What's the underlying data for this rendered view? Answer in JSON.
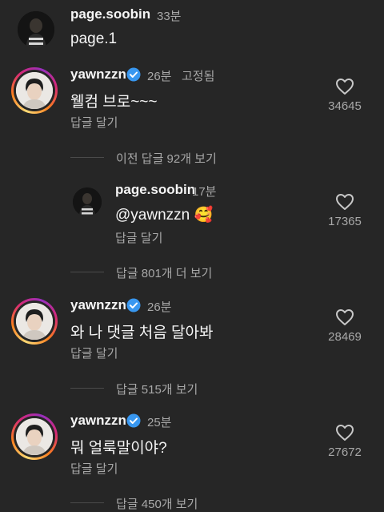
{
  "top_comment": {
    "username": "page.soobin",
    "time": "33분",
    "text": "page.1"
  },
  "comments": [
    {
      "username": "yawnzzn",
      "time": "26분",
      "pinned": "고정됨",
      "text": "웰컴 브로~~~",
      "reply": "답글 달기",
      "likes": "34645",
      "verified": true
    },
    {
      "username": "yawnzzn",
      "time": "26분",
      "text": "와 나 댓글 처음 달아봐",
      "reply": "답글 달기",
      "likes": "28469",
      "verified": true
    },
    {
      "username": "yawnzzn",
      "time": "25분",
      "text": "뭐 얼룩말이야?",
      "reply": "답글 달기",
      "likes": "27672",
      "verified": true
    }
  ],
  "prev_replies": "이전 답글 92개 보기",
  "reply": {
    "username": "page.soobin",
    "time": "17분",
    "text": "@yawnzzn 🥰",
    "reply_label": "답글 달기",
    "likes": "17365"
  },
  "more_replies": [
    "답글 801개 더 보기",
    "답글 515개 보기",
    "답글 450개 보기"
  ],
  "colors": {
    "background": "#262626",
    "text": "#f5f5f5",
    "muted": "#a8a8a8",
    "verified": "#3897f0"
  }
}
